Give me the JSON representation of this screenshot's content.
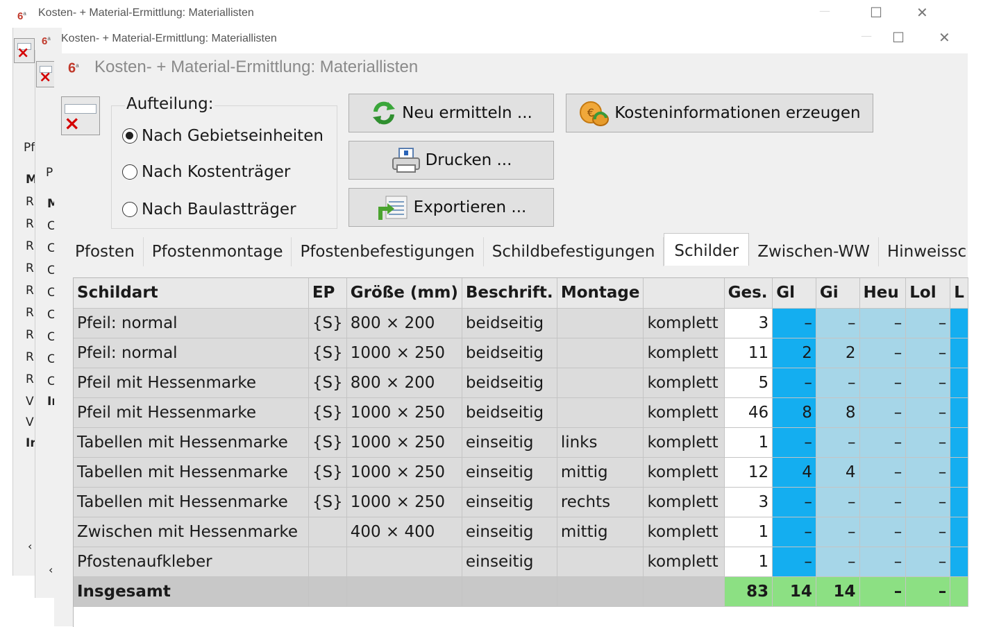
{
  "window": {
    "title": "Kosten- + Material-Ermittlung: Materiallisten",
    "icon_label": "6",
    "icon_sup": "a"
  },
  "controls": {
    "minimize": "—",
    "maximize": "☐",
    "close": "✕"
  },
  "background_strip": {
    "outer_letters": [
      "Pf",
      "M",
      "R",
      "R",
      "R",
      "R",
      "R",
      "R",
      "R",
      "R",
      "R",
      "V",
      "V",
      "Ir"
    ],
    "inner_letters": [
      "P",
      "M",
      "C",
      "C",
      "C",
      "C",
      "C",
      "C",
      "C",
      "C",
      "Ir"
    ],
    "scroll_arrow": "‹"
  },
  "aufteilung": {
    "label": "Aufteilung:",
    "options": [
      {
        "label": "Nach Gebietseinheiten",
        "checked": true
      },
      {
        "label": "Nach Kostenträger",
        "checked": false
      },
      {
        "label": "Nach Baulastträger",
        "checked": false
      }
    ]
  },
  "buttons": {
    "neu": "Neu ermitteln ...",
    "drucken": "Drucken ...",
    "exportieren": "Exportieren ...",
    "kosten": "Kosteninformationen erzeugen"
  },
  "tabs": [
    "Pfosten",
    "Pfostenmontage",
    "Pfostenbefestigungen",
    "Schildbefestigungen",
    "Schilder",
    "Zwischen-WW",
    "Hinweissc"
  ],
  "active_tab": "Schilder",
  "table": {
    "headers": [
      "Schildart",
      "EP",
      "Größe (mm)",
      "Beschrift.",
      "Montage",
      "",
      "Ges.",
      "Gl",
      "Gi",
      "Heu",
      "Lol",
      "L"
    ],
    "rows": [
      [
        "Pfeil: normal",
        "{S}",
        "800 × 200",
        "beidseitig",
        "",
        "komplett",
        "3",
        "–",
        "–",
        "–",
        "–"
      ],
      [
        "Pfeil: normal",
        "{S}",
        "1000 × 250",
        "beidseitig",
        "",
        "komplett",
        "11",
        "2",
        "2",
        "–",
        "–"
      ],
      [
        "Pfeil mit Hessenmarke",
        "{S}",
        "800 × 200",
        "beidseitig",
        "",
        "komplett",
        "5",
        "–",
        "–",
        "–",
        "–"
      ],
      [
        "Pfeil mit Hessenmarke",
        "{S}",
        "1000 × 250",
        "beidseitig",
        "",
        "komplett",
        "46",
        "8",
        "8",
        "–",
        "–"
      ],
      [
        "Tabellen mit Hessenmarke",
        "{S}",
        "1000 × 250",
        "einseitig",
        "links",
        "komplett",
        "1",
        "–",
        "–",
        "–",
        "–"
      ],
      [
        "Tabellen mit Hessenmarke",
        "{S}",
        "1000 × 250",
        "einseitig",
        "mittig",
        "komplett",
        "12",
        "4",
        "4",
        "–",
        "–"
      ],
      [
        "Tabellen mit Hessenmarke",
        "{S}",
        "1000 × 250",
        "einseitig",
        "rechts",
        "komplett",
        "3",
        "–",
        "–",
        "–",
        "–"
      ],
      [
        "Zwischen mit Hessenmarke",
        "",
        "400 × 400",
        "einseitig",
        "mittig",
        "komplett",
        "1",
        "–",
        "–",
        "–",
        "–"
      ],
      [
        "Pfostenaufkleber",
        "",
        "",
        "einseitig",
        "",
        "komplett",
        "1",
        "–",
        "–",
        "–",
        "–"
      ]
    ],
    "total": [
      "Insgesamt",
      "",
      "",
      "",
      "",
      "",
      "83",
      "14",
      "14",
      "–",
      "–"
    ]
  },
  "colors": {
    "blue": "#14aef0",
    "light_blue": "#a6d6e8",
    "green": "#8ce083"
  }
}
